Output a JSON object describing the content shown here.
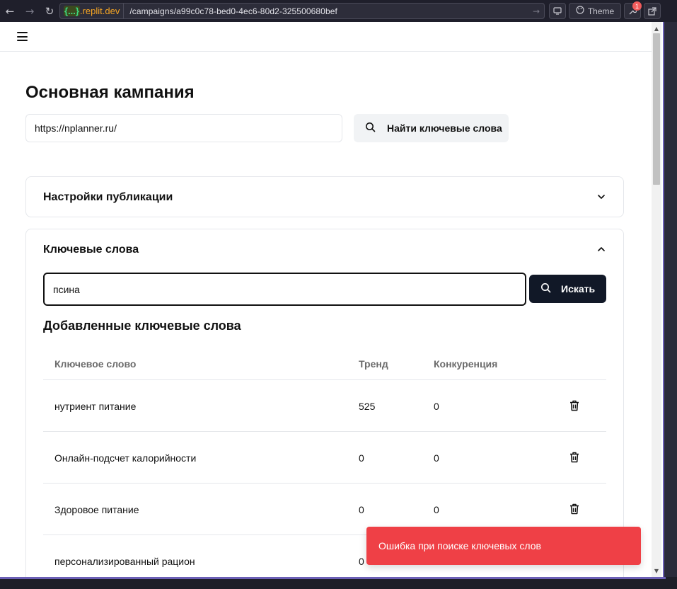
{
  "browser": {
    "domain_brace": "{...}",
    "domain_host": ".replit.dev",
    "path": "/campaigns/a99c0c78-bed0-4ec6-80d2-325500680bef",
    "theme_label": "Theme",
    "badge_count": "1"
  },
  "page": {
    "title": "Основная кампания",
    "site_url_value": "https://nplanner.ru/",
    "find_button_label": "Найти ключевые слова"
  },
  "publish_settings": {
    "title": "Настройки публикации"
  },
  "keywords": {
    "title": "Ключевые слова",
    "search_value": "псина",
    "search_button_label": "Искать",
    "added_title": "Добавленные ключевые слова",
    "columns": [
      "Ключевое слово",
      "Тренд",
      "Конкуренция"
    ],
    "rows": [
      {
        "keyword": "нутриент питание",
        "trend": "525",
        "competition": "0"
      },
      {
        "keyword": "Онлайн-подсчет калорийности",
        "trend": "0",
        "competition": "0"
      },
      {
        "keyword": "Здоровое питание",
        "trend": "0",
        "competition": "0"
      },
      {
        "keyword": "персонализированный рацион",
        "trend": "0",
        "competition": ""
      }
    ]
  },
  "toast": {
    "message": "Ошибка при поиске ключевых слов",
    "color": "#ef4046"
  },
  "colors": {
    "primary_button": "#111827",
    "accent_frame": "#6b5fb5"
  }
}
